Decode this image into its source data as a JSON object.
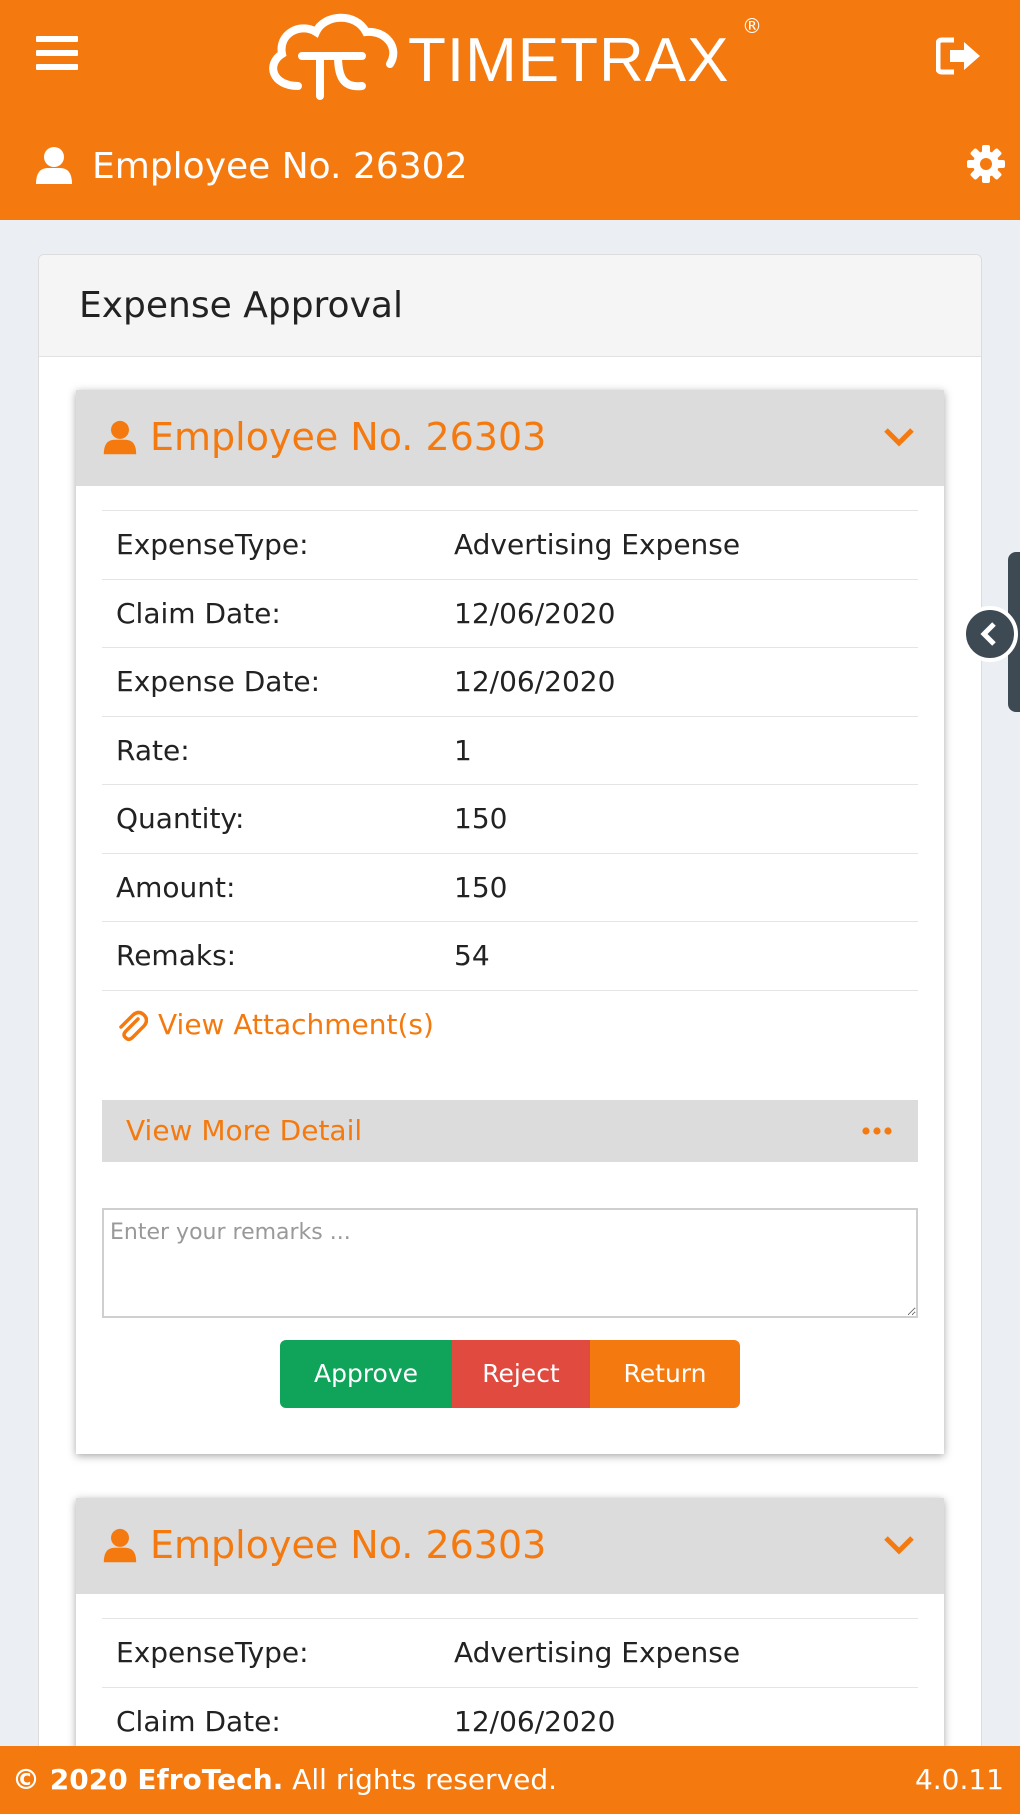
{
  "header": {
    "logo_text": "TIMETRAX",
    "logo_registered": "®",
    "icons": {
      "menu": "hamburger-icon",
      "logout": "sign-out-icon",
      "settings": "gear-icon",
      "user": "user-icon"
    }
  },
  "subheader": {
    "title": "Employee No. 26302"
  },
  "panel": {
    "title": "Expense Approval"
  },
  "cards": [
    {
      "title": "Employee No. 26303",
      "rows": [
        {
          "label": "ExpenseType:",
          "value": "Advertising Expense"
        },
        {
          "label": "Claim Date:",
          "value": "12/06/2020"
        },
        {
          "label": "Expense Date:",
          "value": "12/06/2020"
        },
        {
          "label": "Rate:",
          "value": "1"
        },
        {
          "label": "Quantity:",
          "value": "150"
        },
        {
          "label": "Amount:",
          "value": "150"
        },
        {
          "label": "Remaks:",
          "value": "54"
        }
      ],
      "attachment_link": "View Attachment(s)",
      "more_detail_label": "View More Detail",
      "remarks_placeholder": "Enter your remarks ...",
      "buttons": {
        "approve": "Approve",
        "reject": "Reject",
        "return": "Return"
      }
    },
    {
      "title": "Employee No. 26303",
      "rows": [
        {
          "label": "ExpenseType:",
          "value": "Advertising Expense"
        },
        {
          "label": "Claim Date:",
          "value": "12/06/2020"
        }
      ]
    }
  ],
  "footer": {
    "copyright_brand": "© 2020 EfroTech.",
    "copyright_rest": " All rights reserved.",
    "version": "4.0.11"
  },
  "colors": {
    "brand": "#f47a10",
    "approve": "#10a35a",
    "reject": "#e04a3f",
    "page_bg": "#ebeef2"
  }
}
